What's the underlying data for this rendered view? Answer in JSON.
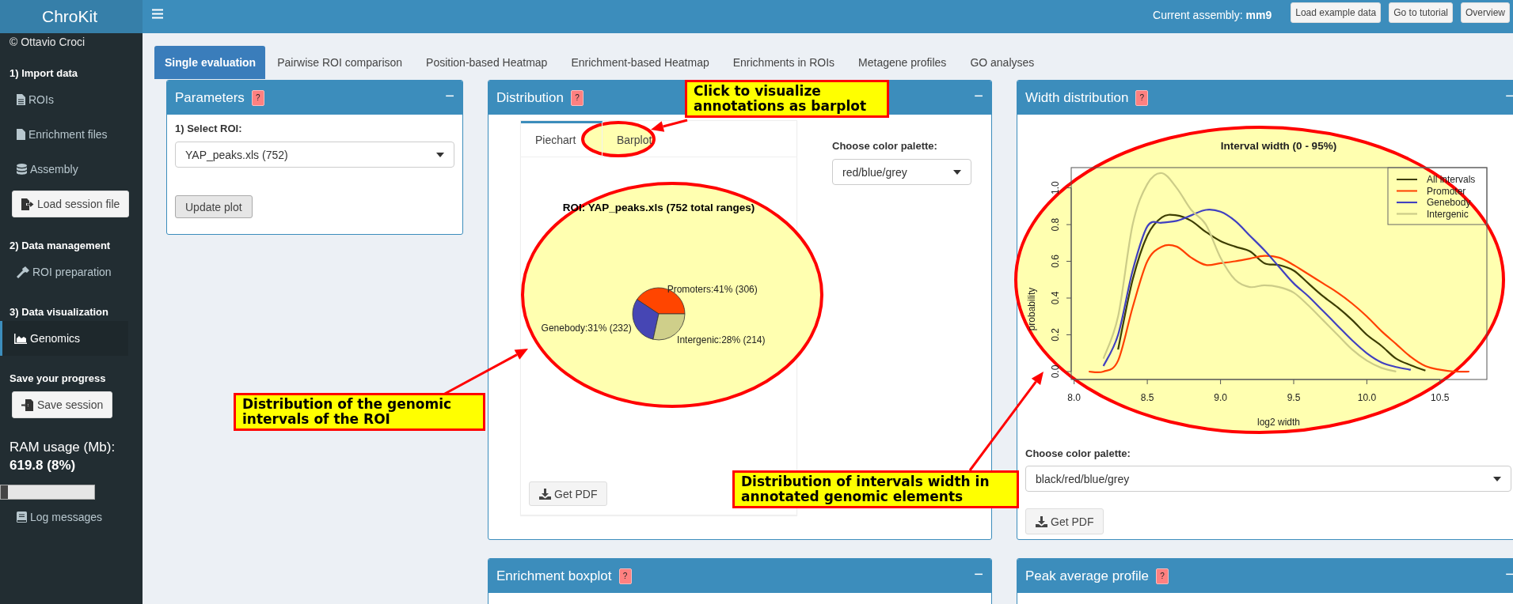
{
  "header": {
    "logo": "ChroKit",
    "assembly": "Current assembly: **mm9**",
    "buttons": [
      "Load example data",
      "Go to tutorial",
      "Overview"
    ]
  },
  "sidebar": {
    "entries": [
      {
        "kind": "credit",
        "text": "© Ottavio Croci"
      },
      {
        "kind": "heading",
        "text": "1) Import data"
      },
      {
        "kind": "item",
        "label": "ROIs",
        "selected": false
      },
      {
        "kind": "item",
        "label": "Enrichment files",
        "selected": false
      },
      {
        "kind": "item",
        "label": "Assembly",
        "selected": false
      },
      {
        "kind": "button",
        "label": "Load session file"
      },
      {
        "kind": "heading",
        "text": "2) Data management"
      },
      {
        "kind": "item",
        "label": "ROI preparation",
        "selected": false
      },
      {
        "kind": "heading",
        "text": "3) Data visualization"
      },
      {
        "kind": "item",
        "label": "Genomics",
        "selected": true
      },
      {
        "kind": "heading",
        "text": "Save your progress"
      },
      {
        "kind": "button",
        "label": "Save session"
      },
      {
        "kind": "ram",
        "label": "RAM usage (Mb):",
        "value": "619.8 (8%)",
        "level": 0.08
      },
      {
        "kind": "item",
        "label": "Log messages",
        "selected": false
      }
    ]
  },
  "tabs": [
    {
      "label": "Single evaluation",
      "selected": true
    },
    {
      "label": "Pairwise ROI comparison",
      "selected": false
    },
    {
      "label": "Position-based Heatmap",
      "selected": false
    },
    {
      "label": "Enrichment-based Heatmap",
      "selected": false
    },
    {
      "label": "Enrichments in ROIs",
      "selected": false
    },
    {
      "label": "Metagene profiles",
      "selected": false
    },
    {
      "label": "GO analyses",
      "selected": false
    }
  ],
  "parameters": {
    "title": "Parameters",
    "help": "?",
    "collapse": "−",
    "field_label": "1) Select ROI:",
    "select": "YAP_peaks.xls (752)",
    "button": "Update plot"
  },
  "distribution": {
    "title": "Distribution",
    "help": "?",
    "collapse": "−",
    "subtabs": [
      {
        "label": "Piechart",
        "selected": true
      },
      {
        "label": "Barplot",
        "selected": false
      }
    ],
    "chart_data": {
      "type": "pie",
      "title": "ROI: YAP_peaks.xls (752 total ranges)",
      "values": [
        306,
        232,
        214
      ],
      "colors": [
        "#ff4500",
        "#4646b4",
        "#cfcf8a"
      ],
      "value_labels": [
        "Promoters:41% (306)",
        "Genebody:31% (232)",
        "Intergenic:28% (214)"
      ]
    },
    "pdf_button": "Get PDF",
    "palette_label": "Choose color palette:",
    "palette": "red/blue/grey"
  },
  "width": {
    "title": "Width distribution",
    "help": "?",
    "collapse": "−",
    "chart_data": {
      "type": "line",
      "title": "Interval width (0 - 95%)",
      "xlabel": "log2 width",
      "ylabel": "probability",
      "x": [
        8.1,
        8.2,
        8.3,
        8.4,
        8.5,
        8.6,
        8.7,
        8.8,
        8.9,
        9.0,
        9.1,
        9.2,
        9.3,
        9.4,
        9.5,
        9.6,
        9.7,
        9.8,
        9.9,
        10.0,
        10.1,
        10.2,
        10.3,
        10.4,
        10.5,
        10.6,
        10.7
      ],
      "series": [
        {
          "name": "All intervals",
          "color": "#3d3d00",
          "values": [
            null,
            null,
            0.12,
            0.5,
            0.74,
            0.84,
            0.85,
            0.82,
            0.76,
            0.71,
            0.68,
            0.655,
            0.59,
            0.58,
            0.55,
            0.48,
            0.41,
            0.35,
            0.28,
            0.2,
            0.14,
            0.07,
            0.035,
            0.005,
            null,
            null,
            null
          ]
        },
        {
          "name": "Promoter",
          "color": "#ff4000",
          "values": [
            0,
            0,
            0.06,
            0.35,
            0.6,
            0.68,
            0.68,
            0.62,
            0.58,
            0.59,
            0.6,
            0.615,
            0.63,
            0.62,
            0.58,
            0.53,
            0.48,
            0.43,
            0.37,
            0.3,
            0.22,
            0.15,
            0.08,
            0.03,
            0.01,
            0,
            0
          ]
        },
        {
          "name": "Genebody",
          "color": "#4040c0",
          "values": [
            null,
            0.03,
            0.2,
            0.55,
            0.79,
            0.81,
            0.82,
            0.85,
            0.88,
            0.87,
            0.82,
            0.74,
            0.66,
            0.57,
            0.48,
            0.41,
            0.33,
            0.25,
            0.17,
            0.1,
            0.05,
            0.025,
            0.01,
            null,
            null,
            null,
            null
          ]
        },
        {
          "name": "Intergenic",
          "color": "#cccc88",
          "values": [
            null,
            0.07,
            0.3,
            0.8,
            1.02,
            1.08,
            1.0,
            0.88,
            0.8,
            0.62,
            0.5,
            0.46,
            0.47,
            0.46,
            0.43,
            0.36,
            0.28,
            0.2,
            0.12,
            0.06,
            0.02,
            0,
            null,
            null,
            null,
            null,
            null
          ]
        }
      ],
      "legend": "topright",
      "xlim": [
        7.98,
        10.82
      ],
      "ylim": [
        -0.043,
        1.11
      ],
      "xticks": [
        {
          "value": 8,
          "label": "8.0"
        },
        {
          "value": 8.5,
          "label": "8.5"
        },
        {
          "value": 9,
          "label": "9.0"
        },
        {
          "value": 9.5,
          "label": "9.5"
        },
        {
          "value": 10,
          "label": "10.0"
        },
        {
          "value": 10.5,
          "label": "10.5"
        }
      ],
      "yticks": [
        {
          "value": 0,
          "label": "0.0"
        },
        {
          "value": 0.2,
          "label": "0.2"
        },
        {
          "value": 0.4,
          "label": "0.4"
        },
        {
          "value": 0.6,
          "label": "0.6"
        },
        {
          "value": 0.8,
          "label": "0.8"
        },
        {
          "value": 1,
          "label": "1.0"
        }
      ]
    },
    "palette_label": "Choose color palette:",
    "palette": "black/red/blue/grey",
    "pdf_button": "Get PDF"
  },
  "lower_panels": [
    {
      "title": "Enrichment boxplot",
      "help": "?",
      "collapse": "−"
    },
    {
      "title": "Peak average profile",
      "help": "?",
      "collapse": "−"
    }
  ],
  "callouts": [
    {
      "text": "Click to visualize annotations as barplot"
    },
    {
      "text": "Distribution of the genomic intervals of the ROI"
    },
    {
      "text": "Distribution of intervals width in annotated genomic elements"
    }
  ]
}
